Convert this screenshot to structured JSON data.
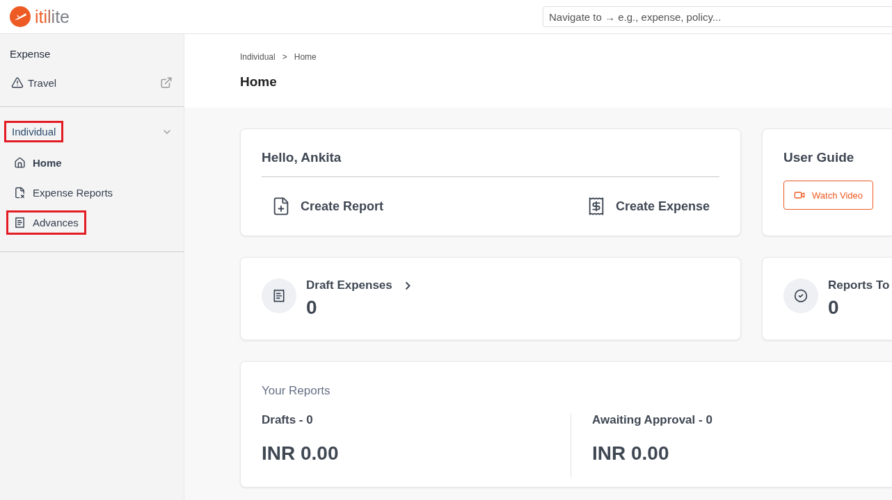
{
  "header": {
    "logo": "itilite",
    "search": {
      "placeholder": "Navigate to → e.g., expense, policy..."
    }
  },
  "sidebar": {
    "section_title": "Expense",
    "travel": {
      "label": "Travel"
    },
    "group": {
      "label": "Individual",
      "expanded": true,
      "highlighted": true,
      "items": [
        {
          "label": "Home",
          "selected": true,
          "highlighted": false
        },
        {
          "label": "Expense Reports",
          "selected": false,
          "highlighted": false
        },
        {
          "label": "Advances",
          "selected": false,
          "highlighted": true
        }
      ]
    }
  },
  "breadcrumb": [
    "Individual",
    ">",
    "Home"
  ],
  "page_title": "Home",
  "greeting_card": {
    "title": "Hello, Ankita",
    "actions": [
      {
        "label": "Create Report"
      },
      {
        "label": "Create Expense"
      }
    ]
  },
  "guide_card": {
    "title": "User Guide",
    "button": "Watch Video"
  },
  "stat_cards": [
    {
      "label": "Draft Expenses",
      "value": "0",
      "arrow": true
    },
    {
      "label": "Reports To",
      "value": "0",
      "arrow": false
    }
  ],
  "reports": {
    "title": "Your Reports",
    "columns": [
      {
        "label": "Drafts - 0",
        "amount": "INR 0.00"
      },
      {
        "label": "Awaiting Approval - 0",
        "amount": "INR 0.00"
      }
    ]
  }
}
